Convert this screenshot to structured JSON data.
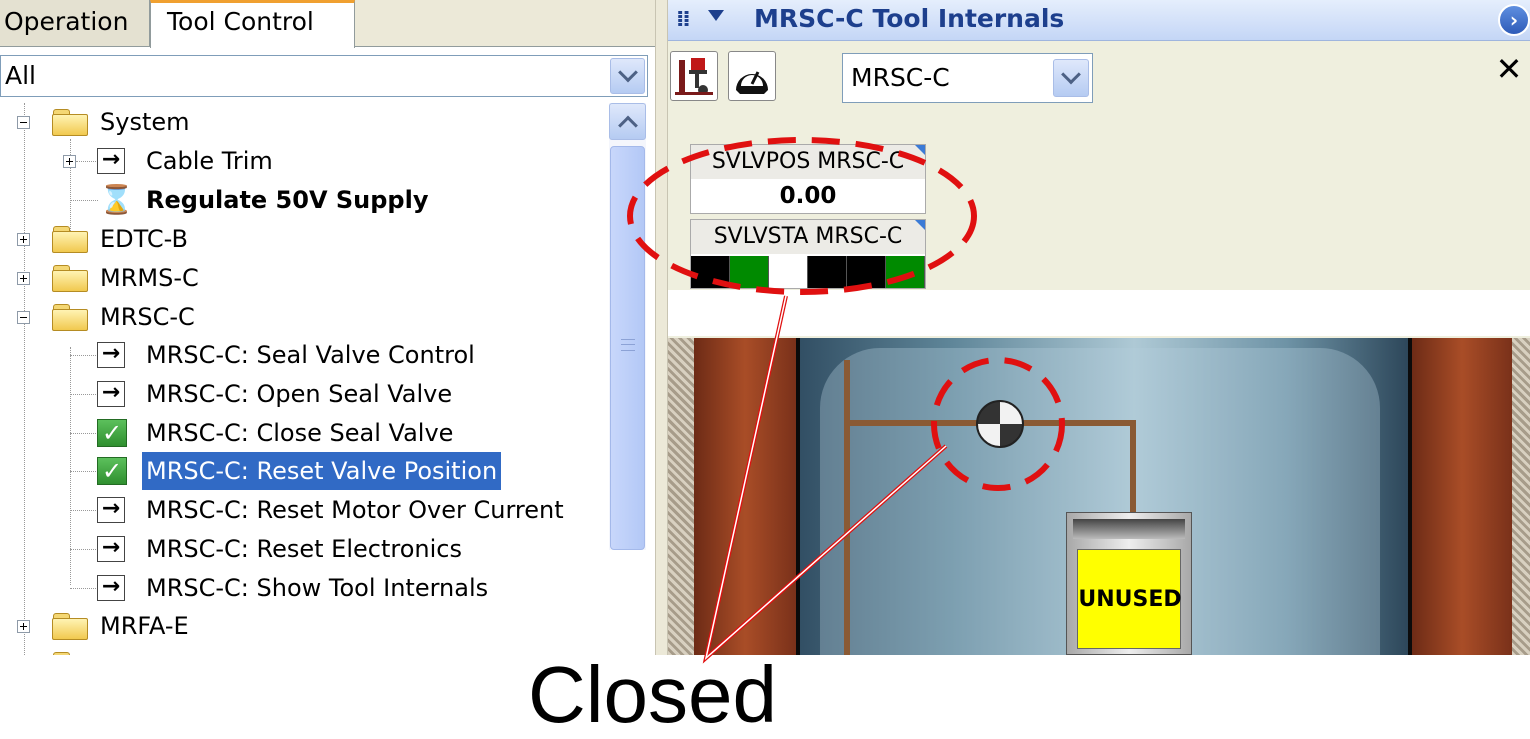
{
  "tabs": [
    {
      "label": "Operation",
      "active": false
    },
    {
      "label": "Tool Control",
      "active": true
    }
  ],
  "filter": {
    "value": "All"
  },
  "tree": {
    "system": {
      "label": "System"
    },
    "cable_trim": {
      "label": "Cable Trim"
    },
    "regulate": {
      "label": "Regulate 50V Supply"
    },
    "edtc_b": {
      "label": "EDTC-B"
    },
    "mrms_c": {
      "label": "MRMS-C"
    },
    "mrsc_c": {
      "label": "MRSC-C"
    },
    "seal_valve_control": {
      "label": "MRSC-C: Seal Valve Control"
    },
    "open_seal_valve": {
      "label": "MRSC-C: Open Seal Valve"
    },
    "close_seal_valve": {
      "label": "MRSC-C: Close Seal Valve"
    },
    "reset_valve_position": {
      "label": "MRSC-C: Reset Valve Position"
    },
    "reset_motor": {
      "label": "MRSC-C: Reset Motor Over Current"
    },
    "reset_electronics": {
      "label": "MRSC-C: Reset Electronics"
    },
    "show_internals": {
      "label": "MRSC-C: Show Tool Internals"
    },
    "mrfa_e": {
      "label": "MRFA-E"
    }
  },
  "panel": {
    "title": "MRSC-C Tool Internals",
    "tool_select": "MRSC-C",
    "close_glyph": "✕",
    "more_glyph": "›"
  },
  "gauges": {
    "svlvpos": {
      "label": "SVLVPOS MRSC-C",
      "value": "0.00"
    },
    "svlvsta": {
      "label": "SVLVSTA MRSC-C",
      "segments": [
        "#000000",
        "#008a00",
        "#ffffff",
        "#000000",
        "#000000",
        "#008a00"
      ]
    }
  },
  "canister": {
    "label": "UNUSED"
  },
  "annotation": {
    "label": "Closed",
    "color": "#e01010"
  },
  "colors": {
    "selection": "#316ac5",
    "title_text": "#1d3f8d",
    "tab_highlight": "#f0a030"
  }
}
